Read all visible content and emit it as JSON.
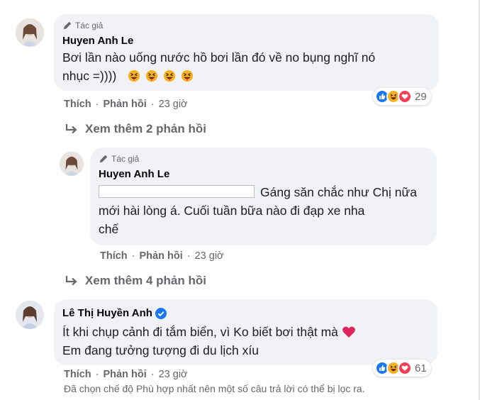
{
  "comments": [
    {
      "badge": "Tác giả",
      "author": "Huyen Anh Le",
      "text_line1": "Bơi lần nào uống nước hồ bơi lần đó về no bụng nghĩ nó",
      "text_line2": "nhục =))))",
      "emoji": [
        "laughing-squint-emoji",
        "laughing-squint-emoji",
        "laughing-squint-emoji",
        "laughing-squint-emoji"
      ],
      "reactions": {
        "icons": [
          "like",
          "haha",
          "love"
        ],
        "count": "29"
      },
      "actions": {
        "like": "Thích",
        "reply": "Phản hồi",
        "time": "23 giờ"
      }
    },
    {
      "badge": "Tác giả",
      "author": "Huyen Anh Le",
      "text_line1": "Gáng săn chắc như Chị nữa",
      "text_line2": "mới hài lòng á. Cuối tuần bữa nào đi đạp xe nha",
      "text_line3": "chế",
      "actions": {
        "like": "Thích",
        "reply": "Phản hồi",
        "time": "23 giờ"
      }
    },
    {
      "author": "Lê Thị Huyền Anh",
      "verified": true,
      "text_line1": "Ít khi chụp cảnh đi tắm biển, vì Ko biết bơi thật mà",
      "text_line2": "Em đang tưởng tượng đi du lịch xíu",
      "reactions": {
        "icons": [
          "like",
          "haha",
          "love"
        ],
        "count": "61"
      },
      "actions": {
        "like": "Thích",
        "reply": "Phản hồi",
        "time": "23 giờ"
      }
    }
  ],
  "more_replies": [
    {
      "label": "Xem thêm 2 phản hồi"
    },
    {
      "label": "Xem thêm 4 phản hồi"
    }
  ],
  "filter_note": "Đã chọn chế độ Phù hợp nhất nên một số câu trả lời có thể bị lọc ra.",
  "colors": {
    "bubble": "#f0f2f5",
    "secondary_text": "#65676b",
    "like_blue": "#1877f2",
    "love_red": "#f33e58",
    "haha_yellow": "#f7b125"
  }
}
